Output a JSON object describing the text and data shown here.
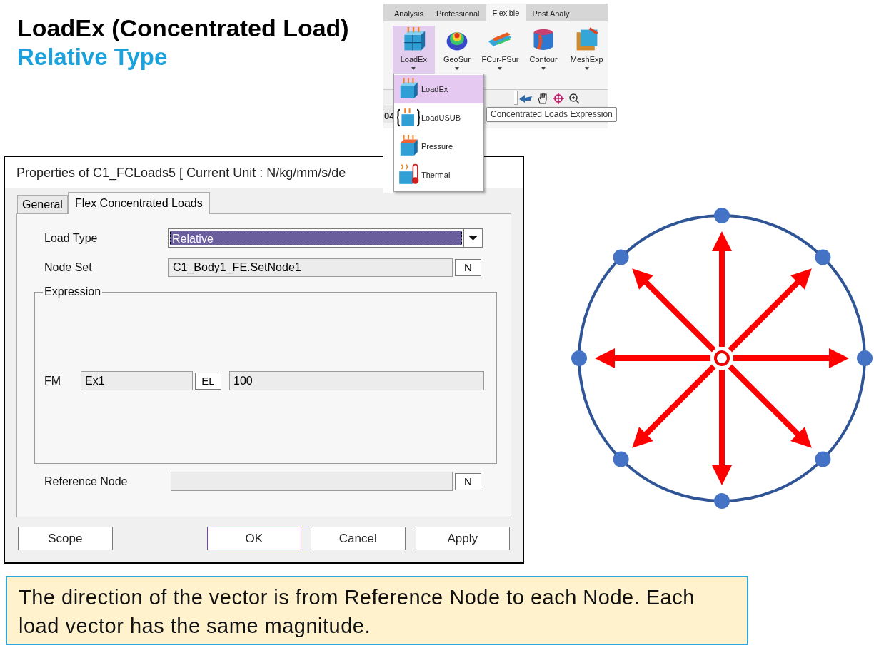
{
  "slide": {
    "title": "LoadEx (Concentrated Load)",
    "subtitle": "Relative Type"
  },
  "ribbon": {
    "tabs": [
      {
        "label": "Analysis",
        "selected": false
      },
      {
        "label": "Professional",
        "selected": false
      },
      {
        "label": "Flexible",
        "selected": true
      },
      {
        "label": "Post Analy",
        "selected": false
      }
    ],
    "buttons": [
      {
        "label": "LoadEx",
        "selected": true
      },
      {
        "label": "GeoSur",
        "selected": false
      },
      {
        "label": "FCur-FSur",
        "selected": false
      },
      {
        "label": "Contour",
        "selected": false
      },
      {
        "label": "MeshExp",
        "selected": false
      }
    ],
    "menu": [
      {
        "label": "LoadEx",
        "selected": true
      },
      {
        "label": "LoadUSUB",
        "selected": false
      },
      {
        "label": "Pressure",
        "selected": false
      },
      {
        "label": "Thermal",
        "selected": false
      }
    ],
    "status_fragment": "04",
    "tooltip": "Concentrated Loads Expression"
  },
  "dialog": {
    "title": "Properties of C1_FCLoads5 [ Current Unit : N/kg/mm/s/de",
    "tabs": [
      {
        "label": "General",
        "selected": false
      },
      {
        "label": "Flex Concentrated Loads",
        "selected": true
      }
    ],
    "load_type": {
      "label": "Load Type",
      "value": "Relative"
    },
    "node_set": {
      "label": "Node Set",
      "value": "C1_Body1_FE.SetNode1",
      "button": "N"
    },
    "expression": {
      "title": "Expression",
      "label": "FM",
      "name": "Ex1",
      "button": "EL",
      "value": "100"
    },
    "reference_node": {
      "label": "Reference Node",
      "button": "N"
    },
    "buttons": [
      {
        "label": "Scope",
        "focused": false
      },
      {
        "label": "OK",
        "focused": true
      },
      {
        "label": "Cancel",
        "focused": false
      },
      {
        "label": "Apply",
        "focused": false
      }
    ]
  },
  "note": "The direction of the vector is from Reference Node to each Node. Each load vector has the same magnitude."
}
